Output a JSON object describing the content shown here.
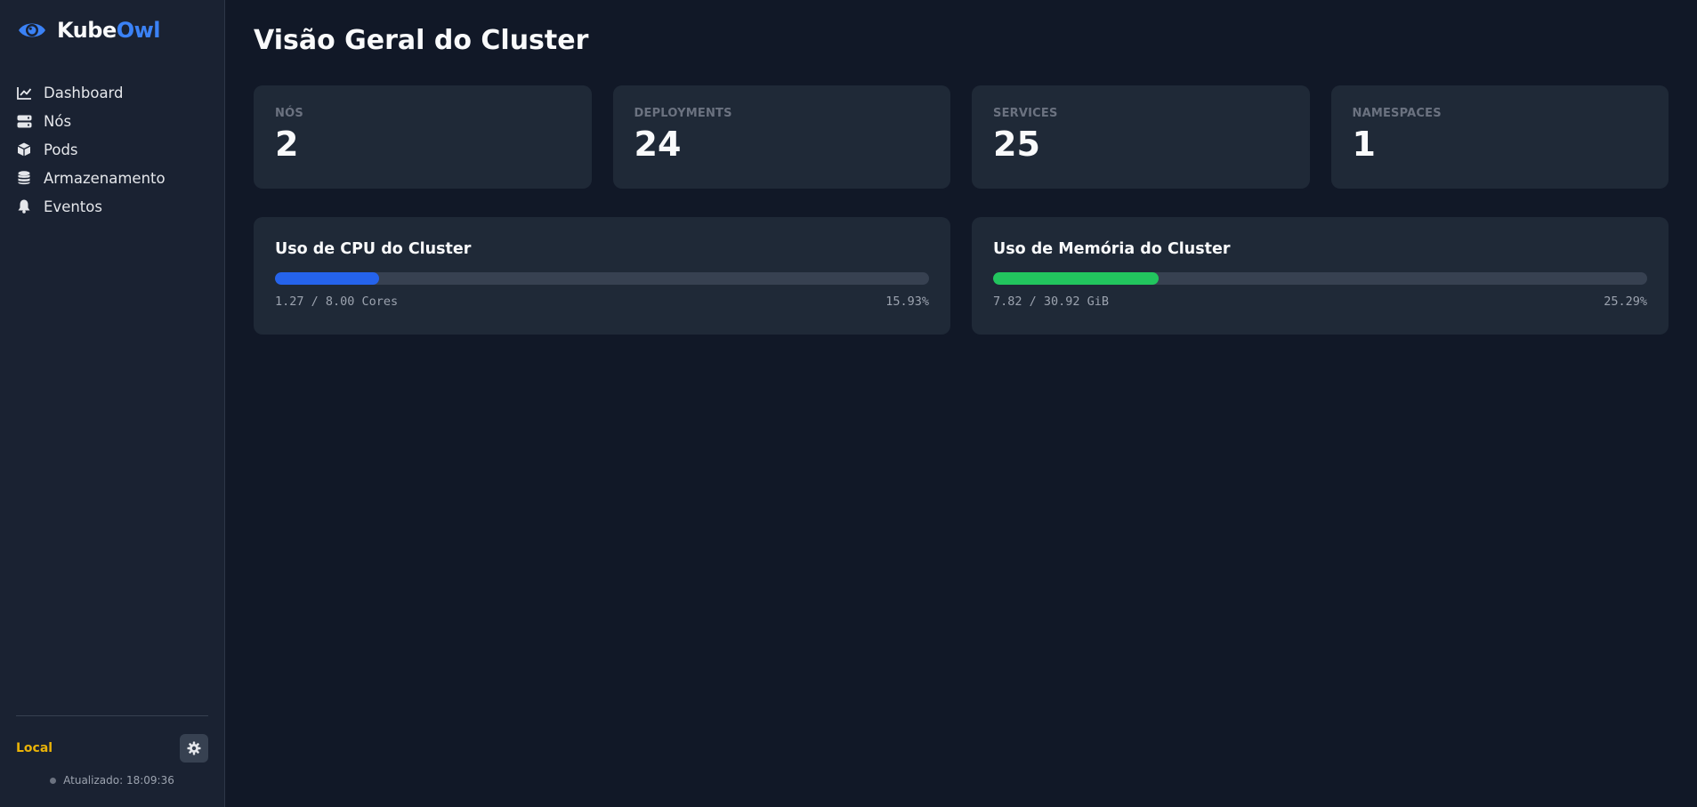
{
  "brand": {
    "name_part1": "Kube",
    "name_part2": "Owl",
    "accent_color": "#3b82f6"
  },
  "sidebar": {
    "items": [
      {
        "label": "Dashboard",
        "icon": "chart-line-icon"
      },
      {
        "label": "Nós",
        "icon": "server-icon"
      },
      {
        "label": "Pods",
        "icon": "cube-icon"
      },
      {
        "label": "Armazenamento",
        "icon": "database-icon"
      },
      {
        "label": "Eventos",
        "icon": "bell-icon"
      }
    ],
    "footer": {
      "context": "Local",
      "context_color": "#eab308",
      "updated": "Atualizado: 18:09:36",
      "settings_icon": "gear-icon"
    }
  },
  "main": {
    "title": "Visão Geral do Cluster",
    "stats": [
      {
        "label": "NÓS",
        "value": "2"
      },
      {
        "label": "DEPLOYMENTS",
        "value": "24"
      },
      {
        "label": "SERVICES",
        "value": "25"
      },
      {
        "label": "NAMESPACES",
        "value": "1"
      }
    ],
    "cpu": {
      "title": "Uso de CPU do Cluster",
      "detail": "1.27 / 8.00 Cores",
      "percent_text": "15.93%",
      "fraction": 0.1593,
      "color": "#2563eb"
    },
    "memory": {
      "title": "Uso de Memória do Cluster",
      "detail": "7.82 / 30.92 GiB",
      "percent_text": "25.29%",
      "fraction": 0.2529,
      "color": "#22c55e"
    }
  }
}
